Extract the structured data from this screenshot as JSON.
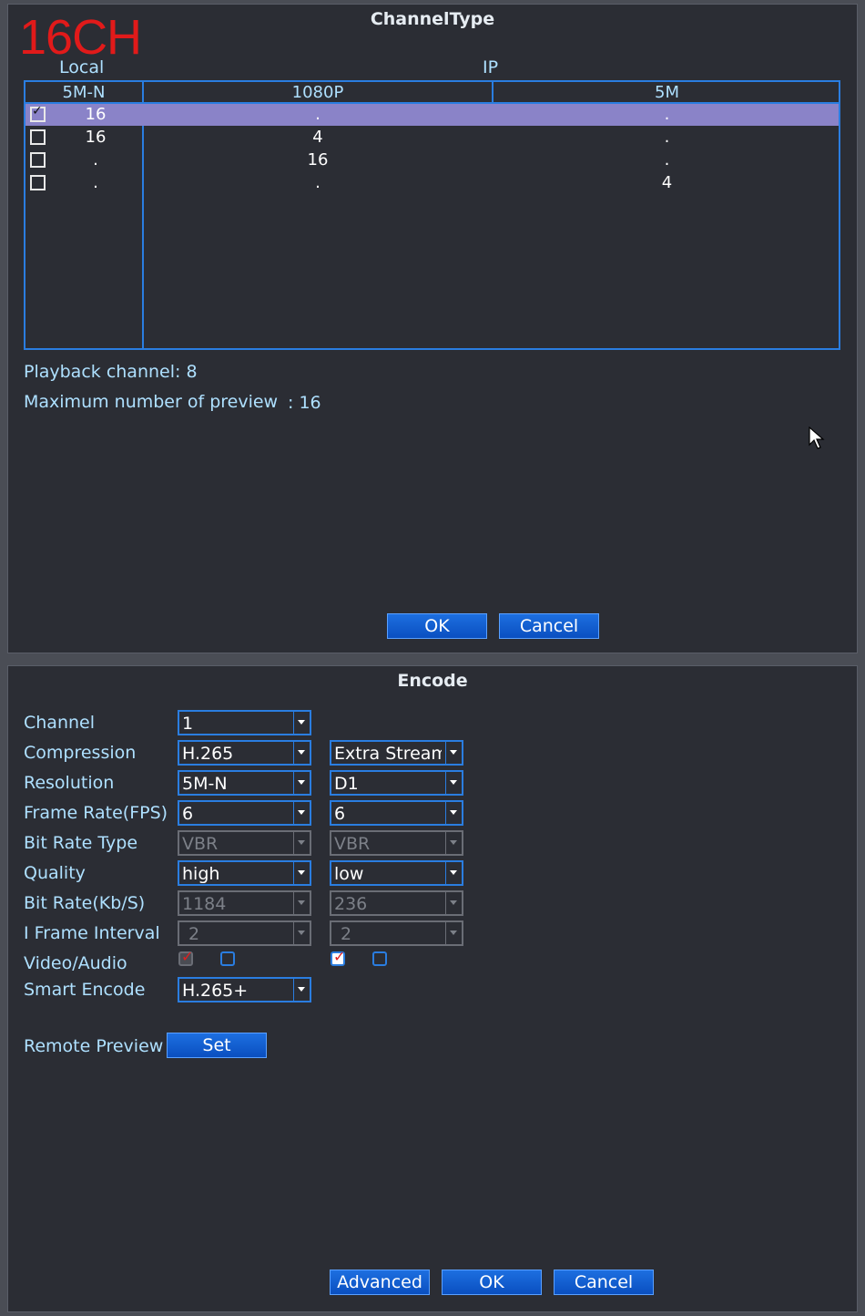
{
  "channel_type": {
    "title": "ChannelType",
    "badge": "16CH",
    "group_local": "Local",
    "group_ip": "IP",
    "columns": [
      "5M-N",
      "1080P",
      "5M"
    ],
    "rows": [
      {
        "checked": true,
        "local": "16",
        "p1080": ".",
        "m5": "."
      },
      {
        "checked": false,
        "local": "16",
        "p1080": "4",
        "m5": "."
      },
      {
        "checked": false,
        "local": ".",
        "p1080": "16",
        "m5": "."
      },
      {
        "checked": false,
        "local": ".",
        "p1080": ".",
        "m5": "4"
      }
    ],
    "playback_label": "Playback channel: 8",
    "preview_label": "Maximum number of preview",
    "preview_value": ": 16",
    "ok": "OK",
    "cancel": "Cancel"
  },
  "encode": {
    "title": "Encode",
    "labels": {
      "channel": "Channel",
      "compression": "Compression",
      "resolution": "Resolution",
      "frame_rate": "Frame Rate(FPS)",
      "bit_rate_type": "Bit Rate Type",
      "quality": "Quality",
      "bit_rate": "Bit Rate(Kb/S)",
      "i_frame": "I Frame Interval",
      "video_audio": "Video/Audio",
      "smart_encode": "Smart Encode",
      "remote_preview": "Remote Preview"
    },
    "main": {
      "channel": "1",
      "compression": "H.265",
      "resolution": "5M-N",
      "frame_rate": "6",
      "bit_rate_type": "VBR",
      "quality": "high",
      "bit_rate": "1184",
      "i_frame": "2",
      "video_checked": true,
      "audio_checked": false,
      "smart_encode": "H.265+"
    },
    "extra": {
      "stream": "Extra Stream",
      "resolution": "D1",
      "frame_rate": "6",
      "bit_rate_type": "VBR",
      "quality": "low",
      "bit_rate": "236",
      "i_frame": "2",
      "video_checked": true,
      "audio_checked": false
    },
    "set": "Set",
    "advanced": "Advanced",
    "ok": "OK",
    "cancel": "Cancel"
  }
}
